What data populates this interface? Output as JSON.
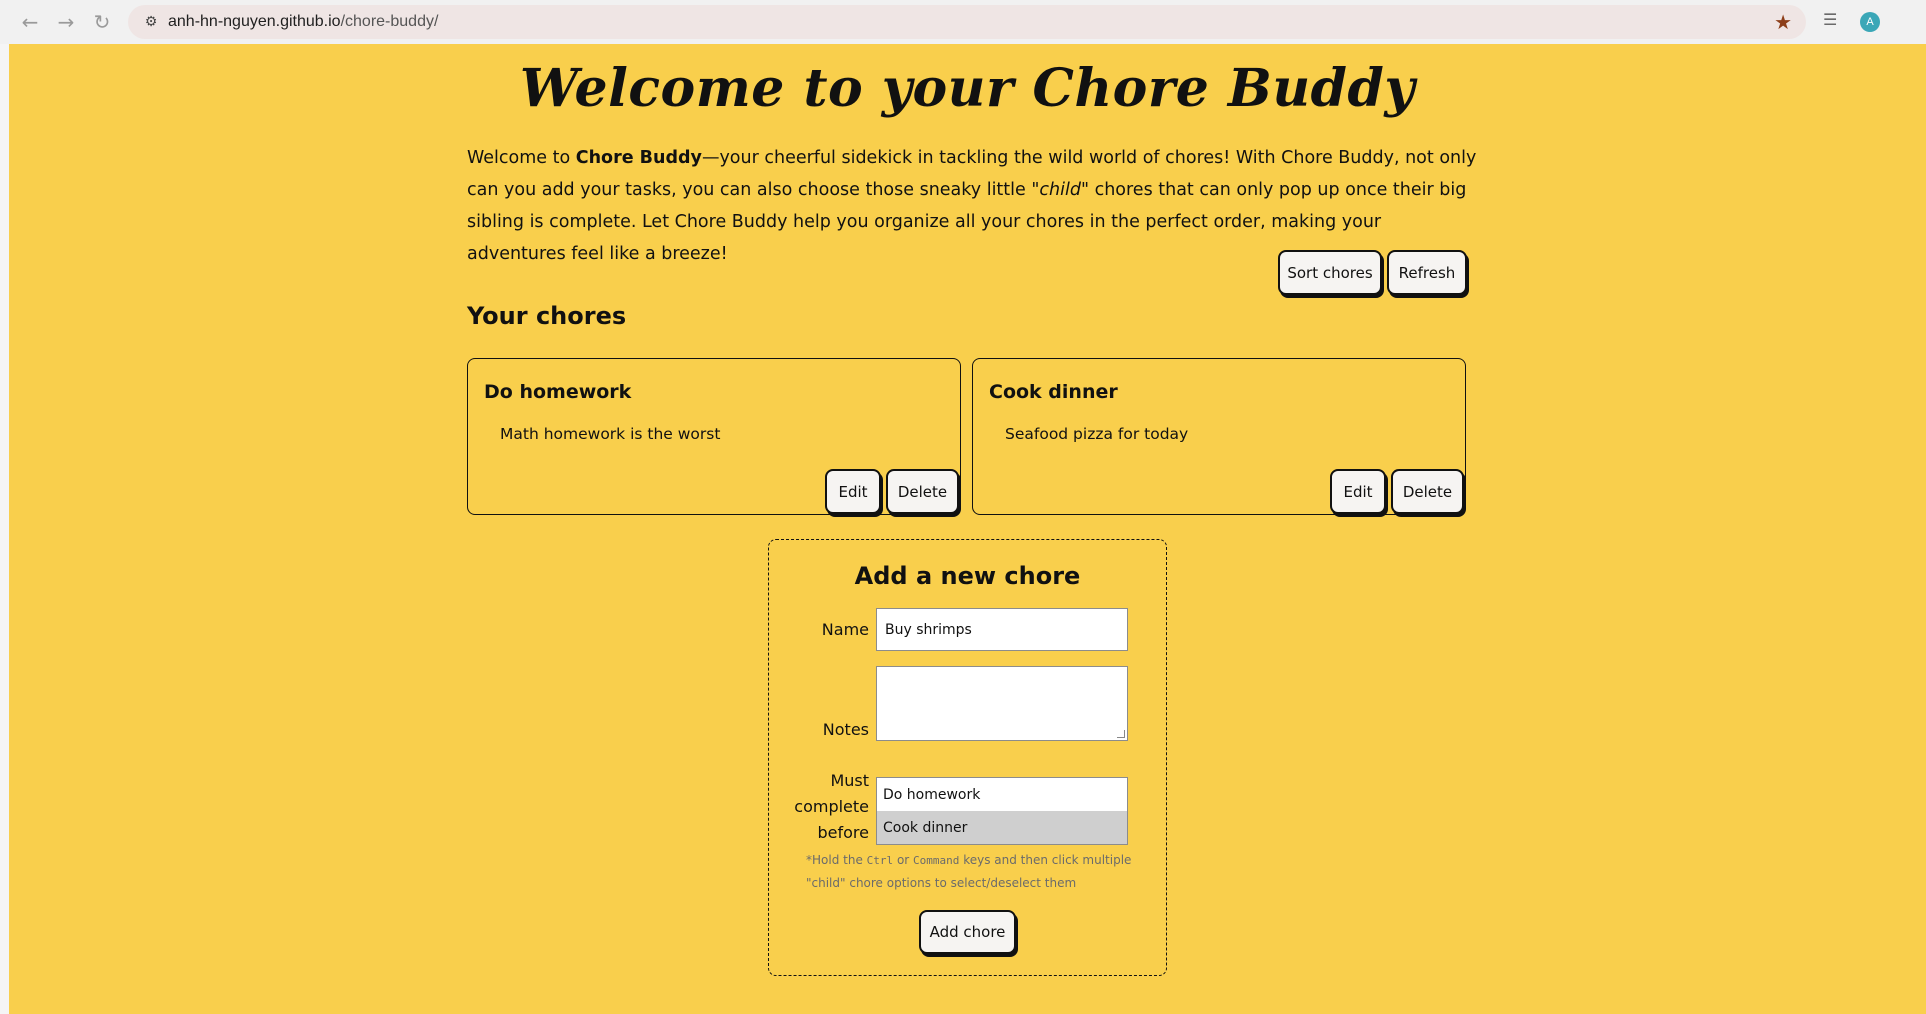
{
  "browser": {
    "url_host": "anh-hn-nguyen.github.io",
    "url_path": "/chore-buddy/",
    "profile_initial": "A",
    "icons": [
      "back-icon",
      "forward-icon",
      "reload-icon",
      "site-info-icon",
      "bookmark-star-icon",
      "reading-list-icon",
      "profile-avatar"
    ]
  },
  "header": {
    "title": "Welcome to your Chore Buddy",
    "intro_before_bold": "Welcome to ",
    "intro_bold": "Chore Buddy",
    "intro_after_bold": "—your cheerful sidekick in tackling the wild world of chores! With Chore Buddy, not only can you add your tasks, you can also choose those sneaky little ",
    "intro_italic": "\"child\"",
    "intro_end": " chores that can only pop up once their big sibling is complete. Let Chore Buddy help you organize all your chores in the perfect order, making your adventures feel like a breeze!"
  },
  "toolbar": {
    "sort_label": "Sort chores",
    "refresh_label": "Refresh"
  },
  "chores": {
    "heading": "Your chores",
    "items": [
      {
        "name": "Do homework",
        "notes": "Math homework is the worst",
        "edit_label": "Edit",
        "delete_label": "Delete"
      },
      {
        "name": "Cook dinner",
        "notes": "Seafood pizza for today",
        "edit_label": "Edit",
        "delete_label": "Delete"
      }
    ]
  },
  "form": {
    "title": "Add a new chore",
    "name_label": "Name",
    "name_value": "Buy shrimps",
    "notes_label": "Notes",
    "notes_value": "",
    "must_complete_label_1": "Must",
    "must_complete_label_2": "complete",
    "must_complete_label_3": "before",
    "options": [
      "Do homework",
      "Cook dinner"
    ],
    "selected_option": "Cook dinner",
    "hint_1": "*Hold the ",
    "hint_ctrl": "Ctrl",
    "hint_2": " or ",
    "hint_cmd": "Command",
    "hint_3": " keys and then click multiple \"child\" chore options to select/deselect them",
    "submit_label": "Add chore"
  },
  "colors": {
    "page_bg": "#f9cf4c",
    "button_bg": "#f6f4f2",
    "text": "#111111",
    "star": "#8d3f1a"
  }
}
